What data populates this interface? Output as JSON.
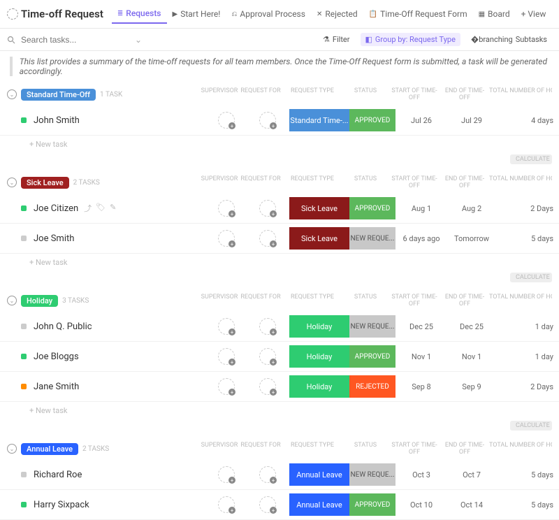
{
  "header": {
    "title": "Time-off Request",
    "tabs": [
      {
        "label": "Requests",
        "active": true
      },
      {
        "label": "Start Here!"
      },
      {
        "label": "Approval Process"
      },
      {
        "label": "Rejected"
      },
      {
        "label": "Time-Off Request Form"
      },
      {
        "label": "Board"
      },
      {
        "label": "+ View"
      }
    ]
  },
  "toolbar": {
    "search_placeholder": "Search tasks...",
    "filter": "Filter",
    "group": "Group by: Request Type",
    "subtasks": "Subtasks"
  },
  "description": "This list provides a summary of the time-off requests for all team members. Once the Time-Off Request form is submitted, a task will be generated accordingly.",
  "columns": {
    "supervisor": "SUPERVISOR",
    "request_for": "REQUEST FOR",
    "request_type": "REQUEST TYPE",
    "status": "STATUS",
    "start": "START OF TIME-OFF",
    "end": "END OF TIME-OFF",
    "total": "TOTAL NUMBER OF HOURS"
  },
  "new_task": "+ New task",
  "calc": "CALCULATE",
  "groups": [
    {
      "name": "Standard Time-Off",
      "badge_class": "std",
      "count": "1 TASK",
      "tasks": [
        {
          "sq": "green",
          "name": "John Smith",
          "type": "Standard Time-...",
          "type_class": "type-std",
          "status": "APPROVED",
          "status_class": "st-app",
          "start": "Jul 26",
          "end": "Jul 29",
          "num": "4 days"
        }
      ]
    },
    {
      "name": "Sick Leave",
      "badge_class": "sick",
      "count": "2 TASKS",
      "tasks": [
        {
          "sq": "green",
          "name": "Joe Citizen",
          "icons": true,
          "type": "Sick Leave",
          "type_class": "type-sick",
          "status": "APPROVED",
          "status_class": "st-app",
          "start": "Aug 1",
          "end": "Aug 2",
          "num": "2 Days"
        },
        {
          "sq": "grey",
          "name": "Joe Smith",
          "type": "Sick Leave",
          "type_class": "type-sick",
          "status": "NEW REQUE...",
          "status_class": "st-new",
          "start": "6 days ago",
          "end": "Tomorrow",
          "num": "5 days"
        }
      ]
    },
    {
      "name": "Holiday",
      "badge_class": "hol",
      "count": "3 TASKS",
      "tasks": [
        {
          "sq": "grey",
          "name": "John Q. Public",
          "type": "Holiday",
          "type_class": "type-hol",
          "status": "NEW REQUE...",
          "status_class": "st-new",
          "start": "Dec 25",
          "end": "Dec 25",
          "num": "1 day"
        },
        {
          "sq": "green",
          "name": "Joe Bloggs",
          "type": "Holiday",
          "type_class": "type-hol",
          "status": "APPROVED",
          "status_class": "st-app",
          "start": "Nov 1",
          "end": "Nov 1",
          "num": "1 day"
        },
        {
          "sq": "orange",
          "name": "Jane Smith",
          "type": "Holiday",
          "type_class": "type-hol",
          "status": "REJECTED",
          "status_class": "st-rej",
          "start": "Sep 8",
          "end": "Sep 9",
          "num": "2 Days"
        }
      ]
    },
    {
      "name": "Annual Leave",
      "badge_class": "ann",
      "count": "2 TASKS",
      "tasks": [
        {
          "sq": "grey",
          "name": "Richard Roe",
          "type": "Annual Leave",
          "type_class": "type-ann",
          "status": "NEW REQUE...",
          "status_class": "st-new",
          "start": "Oct 3",
          "end": "Oct 7",
          "num": "5 days"
        },
        {
          "sq": "green",
          "name": "Harry Sixpack",
          "type": "Annual Leave",
          "type_class": "type-ann",
          "status": "APPROVED",
          "status_class": "st-app",
          "start": "Oct 10",
          "end": "Oct 14",
          "num": "5 days"
        }
      ]
    }
  ]
}
